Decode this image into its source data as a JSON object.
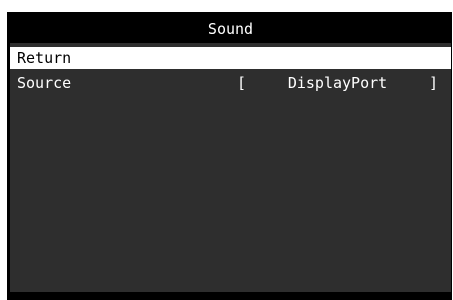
{
  "window": {
    "title": "Sound"
  },
  "menu": {
    "items": [
      {
        "label": "Return",
        "selected": true
      },
      {
        "label": "Source",
        "value": "DisplayPort",
        "bracket_left": "[",
        "bracket_right": "]",
        "selected": false
      }
    ]
  },
  "colors": {
    "background": "#2e2e2e",
    "title_bar": "#000000",
    "highlight": "#ffffff",
    "text": "#ffffff"
  }
}
